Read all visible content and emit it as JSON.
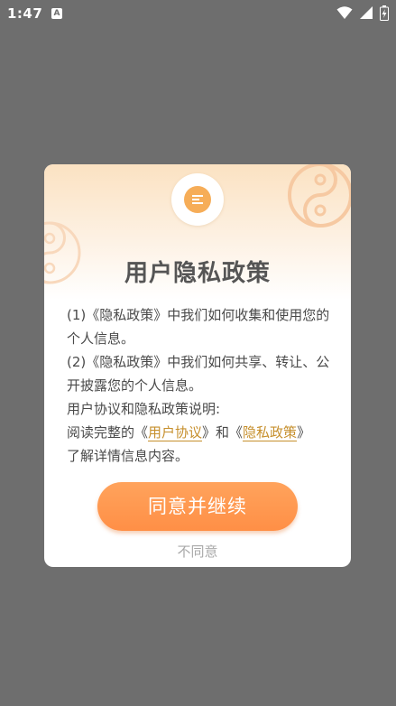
{
  "status_bar": {
    "time": "1:47",
    "notification_badge": "A"
  },
  "dialog": {
    "title": "用户隐私政策",
    "body": [
      "(1)《隐私政策》中我们如何收集和使用您的个人信息。",
      "(2)《隐私政策》中我们如何共享、转让、公开披露您的个人信息。",
      "用户协议和隐私政策说明:"
    ],
    "read_prefix": "阅读完整的《",
    "user_agreement_link": "用户协议",
    "read_middle": "》和《",
    "privacy_policy_link": "隐私政策",
    "read_suffix": "》",
    "read_end": "了解详情信息内容。",
    "agree_label": "同意并继续",
    "disagree_label": "不同意"
  },
  "colors": {
    "overlay": "#6e6e6e",
    "accent_orange": "#ff9a52",
    "link_gold": "#c68f2c",
    "icon_orange": "#f6ad58"
  }
}
